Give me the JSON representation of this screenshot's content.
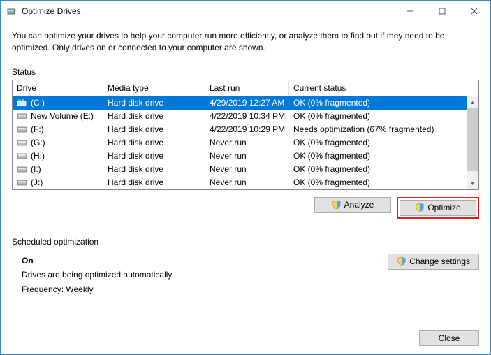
{
  "window": {
    "title": "Optimize Drives"
  },
  "intro": "You can optimize your drives to help your computer run more efficiently, or analyze them to find out if they need to be optimized. Only drives on or connected to your computer are shown.",
  "status_label": "Status",
  "columns": {
    "drive": "Drive",
    "media": "Media type",
    "last": "Last run",
    "status": "Current status"
  },
  "rows": [
    {
      "icon": "os",
      "name": "(C:)",
      "media": "Hard disk drive",
      "last": "4/29/2019 12:27 AM",
      "status": "OK (0% fragmented)",
      "selected": true
    },
    {
      "icon": "hdd",
      "name": "New Volume (E:)",
      "media": "Hard disk drive",
      "last": "4/22/2019 10:34 PM",
      "status": "OK (0% fragmented)"
    },
    {
      "icon": "hdd",
      "name": "(F:)",
      "media": "Hard disk drive",
      "last": "4/22/2019 10:29 PM",
      "status": "Needs optimization (67% fragmented)"
    },
    {
      "icon": "hdd",
      "name": "(G:)",
      "media": "Hard disk drive",
      "last": "Never run",
      "status": "OK (0% fragmented)"
    },
    {
      "icon": "hdd",
      "name": "(H:)",
      "media": "Hard disk drive",
      "last": "Never run",
      "status": "OK (0% fragmented)"
    },
    {
      "icon": "hdd",
      "name": "(I:)",
      "media": "Hard disk drive",
      "last": "Never run",
      "status": "OK (0% fragmented)"
    },
    {
      "icon": "hdd",
      "name": "(J:)",
      "media": "Hard disk drive",
      "last": "Never run",
      "status": "OK (0% fragmented)"
    }
  ],
  "buttons": {
    "analyze": "Analyze",
    "optimize": "Optimize",
    "change": "Change settings",
    "close": "Close"
  },
  "sched": {
    "label": "Scheduled optimization",
    "state": "On",
    "desc": "Drives are being optimized automatically.",
    "freq": "Frequency: Weekly"
  }
}
